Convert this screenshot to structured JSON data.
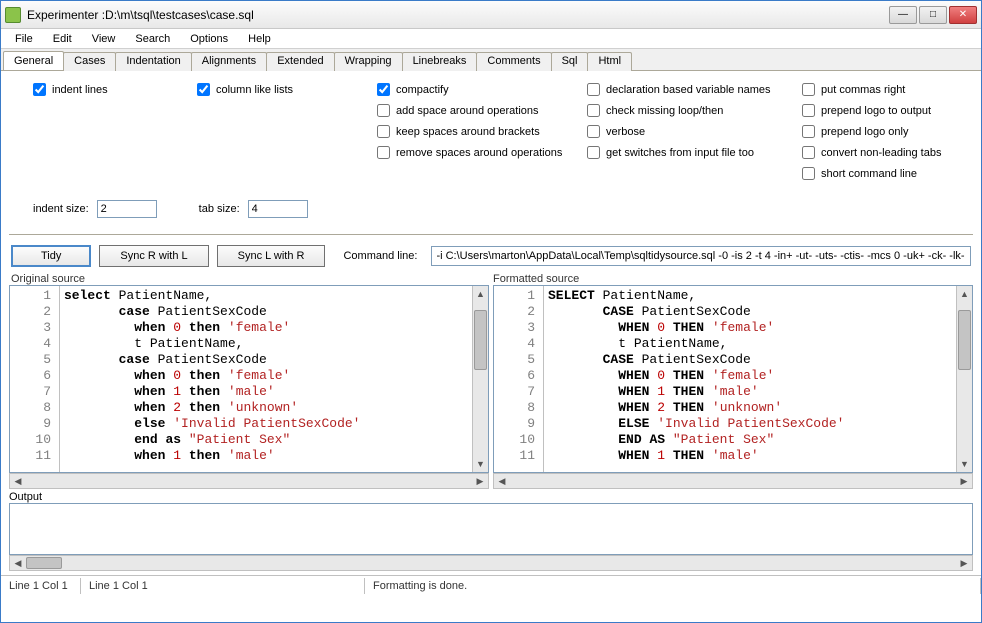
{
  "title": "Experimenter :D:\\m\\tsql\\testcases\\case.sql",
  "menu": {
    "file": "File",
    "edit": "Edit",
    "view": "View",
    "search": "Search",
    "options": "Options",
    "help": "Help"
  },
  "tabs": [
    "General",
    "Cases",
    "Indentation",
    "Alignments",
    "Extended",
    "Wrapping",
    "Linebreaks",
    "Comments",
    "Sql",
    "Html"
  ],
  "opts": {
    "indent_lines": {
      "label": "indent lines",
      "checked": true
    },
    "column_like_lists": {
      "label": "column like lists",
      "checked": true
    },
    "compactify": {
      "label": "compactify",
      "checked": true
    },
    "add_space_ops": {
      "label": "add space around operations",
      "checked": false
    },
    "keep_spaces_brackets": {
      "label": "keep spaces around brackets",
      "checked": false
    },
    "remove_spaces_ops": {
      "label": "remove spaces around operations",
      "checked": false
    },
    "decl_based_names": {
      "label": "declaration based variable names",
      "checked": false
    },
    "check_missing_loop": {
      "label": "check missing loop/then",
      "checked": false
    },
    "verbose": {
      "label": "verbose",
      "checked": false
    },
    "get_switches": {
      "label": "get switches from input file  too",
      "checked": false
    },
    "put_commas_right": {
      "label": "put commas right",
      "checked": false
    },
    "prepend_logo_output": {
      "label": "prepend logo to output",
      "checked": false
    },
    "prepend_logo_only": {
      "label": "prepend logo only",
      "checked": false
    },
    "convert_non_leading_tabs": {
      "label": "convert non-leading tabs",
      "checked": false
    },
    "short_command_line": {
      "label": "short command line",
      "checked": false
    }
  },
  "indent_size": {
    "label": "indent size:",
    "value": "2"
  },
  "tab_size": {
    "label": "tab size:",
    "value": "4"
  },
  "buttons": {
    "tidy": "Tidy",
    "sync_r_with_l": "Sync R with L",
    "sync_l_with_r": "Sync L with R"
  },
  "cmdline": {
    "label": "Command line:",
    "value": "-i C:\\Users\\marton\\AppData\\Local\\Temp\\sqltidysource.sql -0 -is 2 -t 4 -in+ -ut- -uts- -ctis- -mcs 0 -uk+ -ck- -lk- -ui- -"
  },
  "panel_labels": {
    "left": "Original source",
    "right": "Formatted source"
  },
  "output_label": "Output",
  "left_gutter": "1\n2\n3\n4\n5\n6\n7\n8\n9\n10\n11",
  "left_tokens": [
    [
      "kw",
      "select"
    ],
    [
      "txt",
      " PatientName,\n"
    ],
    [
      "txt",
      "       "
    ],
    [
      "kw",
      "case"
    ],
    [
      "txt",
      " PatientSexCode\n"
    ],
    [
      "txt",
      "         "
    ],
    [
      "kw",
      "when"
    ],
    [
      "txt",
      " "
    ],
    [
      "num",
      "0"
    ],
    [
      "txt",
      " "
    ],
    [
      "kw",
      "then"
    ],
    [
      "txt",
      " "
    ],
    [
      "str",
      "'female'"
    ],
    [
      "txt",
      "\n"
    ],
    [
      "txt",
      "         t PatientName,\n"
    ],
    [
      "txt",
      "       "
    ],
    [
      "kw",
      "case"
    ],
    [
      "txt",
      " PatientSexCode\n"
    ],
    [
      "txt",
      "         "
    ],
    [
      "kw",
      "when"
    ],
    [
      "txt",
      " "
    ],
    [
      "num",
      "0"
    ],
    [
      "txt",
      " "
    ],
    [
      "kw",
      "then"
    ],
    [
      "txt",
      " "
    ],
    [
      "str",
      "'female'"
    ],
    [
      "txt",
      "\n"
    ],
    [
      "txt",
      "         "
    ],
    [
      "kw",
      "when"
    ],
    [
      "txt",
      " "
    ],
    [
      "num",
      "1"
    ],
    [
      "txt",
      " "
    ],
    [
      "kw",
      "then"
    ],
    [
      "txt",
      " "
    ],
    [
      "str",
      "'male'"
    ],
    [
      "txt",
      "\n"
    ],
    [
      "txt",
      "         "
    ],
    [
      "kw",
      "when"
    ],
    [
      "txt",
      " "
    ],
    [
      "num",
      "2"
    ],
    [
      "txt",
      " "
    ],
    [
      "kw",
      "then"
    ],
    [
      "txt",
      " "
    ],
    [
      "str",
      "'unknown'"
    ],
    [
      "txt",
      "\n"
    ],
    [
      "txt",
      "         "
    ],
    [
      "kw",
      "else"
    ],
    [
      "txt",
      " "
    ],
    [
      "str",
      "'Invalid PatientSexCode'"
    ],
    [
      "txt",
      "\n"
    ],
    [
      "txt",
      "         "
    ],
    [
      "kw",
      "end"
    ],
    [
      "txt",
      " "
    ],
    [
      "kw",
      "as"
    ],
    [
      "txt",
      " "
    ],
    [
      "dstr",
      "\"Patient Sex\""
    ],
    [
      "txt",
      "\n"
    ],
    [
      "txt",
      "         "
    ],
    [
      "kw",
      "when"
    ],
    [
      "txt",
      " "
    ],
    [
      "num",
      "1"
    ],
    [
      "txt",
      " "
    ],
    [
      "kw",
      "then"
    ],
    [
      "txt",
      " "
    ],
    [
      "str",
      "'male'"
    ]
  ],
  "right_gutter": "1\n2\n3\n4\n5\n6\n7\n8\n9\n10\n11",
  "right_tokens": [
    [
      "kw",
      "SELECT"
    ],
    [
      "txt",
      " PatientName,\n"
    ],
    [
      "txt",
      "       "
    ],
    [
      "kw",
      "CASE"
    ],
    [
      "txt",
      " PatientSexCode\n"
    ],
    [
      "txt",
      "         "
    ],
    [
      "kw",
      "WHEN"
    ],
    [
      "txt",
      " "
    ],
    [
      "num",
      "0"
    ],
    [
      "txt",
      " "
    ],
    [
      "kw",
      "THEN"
    ],
    [
      "txt",
      " "
    ],
    [
      "str",
      "'female'"
    ],
    [
      "txt",
      "\n"
    ],
    [
      "txt",
      "         t PatientName,\n"
    ],
    [
      "txt",
      "       "
    ],
    [
      "kw",
      "CASE"
    ],
    [
      "txt",
      " PatientSexCode\n"
    ],
    [
      "txt",
      "         "
    ],
    [
      "kw",
      "WHEN"
    ],
    [
      "txt",
      " "
    ],
    [
      "num",
      "0"
    ],
    [
      "txt",
      " "
    ],
    [
      "kw",
      "THEN"
    ],
    [
      "txt",
      " "
    ],
    [
      "str",
      "'female'"
    ],
    [
      "txt",
      "\n"
    ],
    [
      "txt",
      "         "
    ],
    [
      "kw",
      "WHEN"
    ],
    [
      "txt",
      " "
    ],
    [
      "num",
      "1"
    ],
    [
      "txt",
      " "
    ],
    [
      "kw",
      "THEN"
    ],
    [
      "txt",
      " "
    ],
    [
      "str",
      "'male'"
    ],
    [
      "txt",
      "\n"
    ],
    [
      "txt",
      "         "
    ],
    [
      "kw",
      "WHEN"
    ],
    [
      "txt",
      " "
    ],
    [
      "num",
      "2"
    ],
    [
      "txt",
      " "
    ],
    [
      "kw",
      "THEN"
    ],
    [
      "txt",
      " "
    ],
    [
      "str",
      "'unknown'"
    ],
    [
      "txt",
      "\n"
    ],
    [
      "txt",
      "         "
    ],
    [
      "kw",
      "ELSE"
    ],
    [
      "txt",
      " "
    ],
    [
      "str",
      "'Invalid PatientSexCode'"
    ],
    [
      "txt",
      "\n"
    ],
    [
      "txt",
      "         "
    ],
    [
      "kw",
      "END"
    ],
    [
      "txt",
      " "
    ],
    [
      "kw",
      "AS"
    ],
    [
      "txt",
      " "
    ],
    [
      "dstr",
      "\"Patient Sex\""
    ],
    [
      "txt",
      "\n"
    ],
    [
      "txt",
      "         "
    ],
    [
      "kw",
      "WHEN"
    ],
    [
      "txt",
      " "
    ],
    [
      "num",
      "1"
    ],
    [
      "txt",
      " "
    ],
    [
      "kw",
      "THEN"
    ],
    [
      "txt",
      " "
    ],
    [
      "str",
      "'male'"
    ]
  ],
  "status": {
    "pos1": "Line 1 Col 1",
    "pos2": "Line 1 Col 1",
    "msg": "Formatting is done."
  }
}
